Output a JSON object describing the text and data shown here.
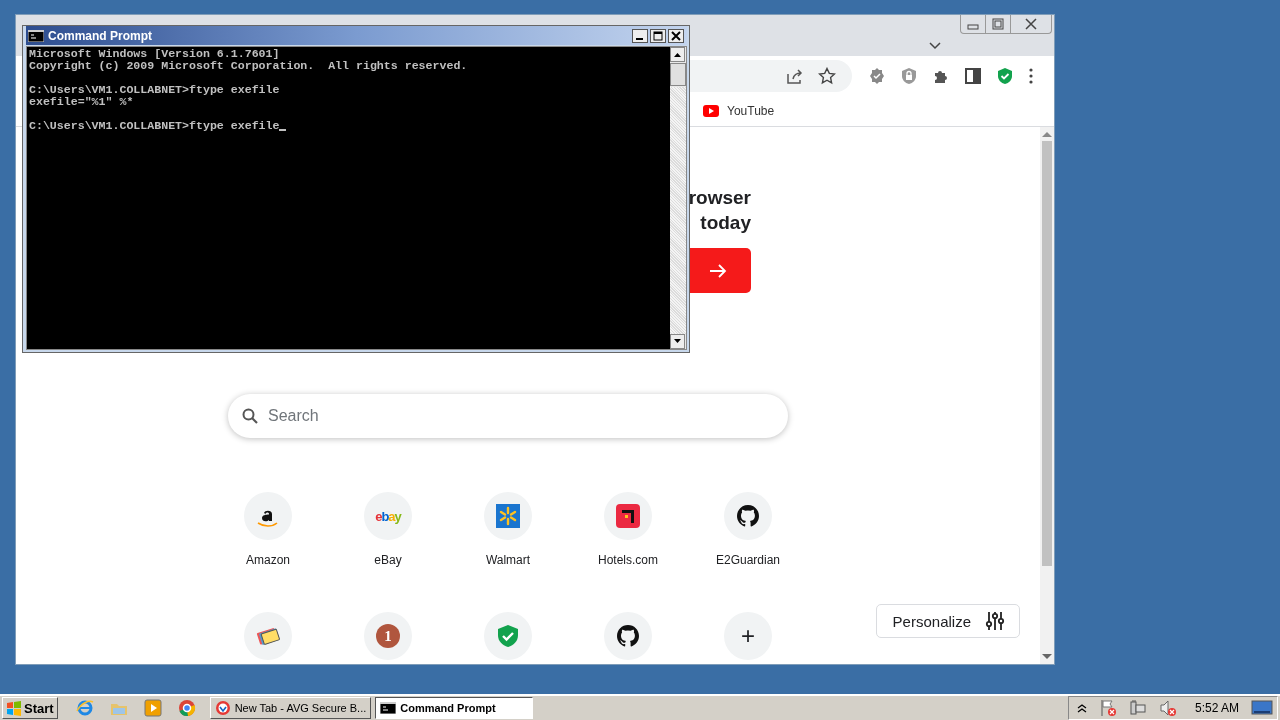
{
  "browser": {
    "bookmarks": [
      {
        "label": "YouTube"
      }
    ],
    "promo": {
      "lines": [
        "rowser",
        "today"
      ]
    },
    "search": {
      "placeholder": "Search"
    },
    "shortcuts": [
      {
        "kind": "amazon",
        "label": "Amazon"
      },
      {
        "kind": "ebay",
        "label": "eBay",
        "logo_text": "ebay"
      },
      {
        "kind": "walmart",
        "label": "Walmart"
      },
      {
        "kind": "hotels",
        "label": "Hotels.com"
      },
      {
        "kind": "github",
        "label": "E2Guardian"
      },
      {
        "kind": "cards"
      },
      {
        "kind": "coin",
        "logo_text": "1"
      },
      {
        "kind": "shield"
      },
      {
        "kind": "github"
      },
      {
        "kind": "add",
        "logo_text": "+"
      }
    ],
    "personalize": "Personalize"
  },
  "cmd": {
    "title": "Command Prompt",
    "blocks": [
      {
        "lines": [
          "Microsoft Windows [Version 6.1.7601]",
          "Copyright (c) 2009 Microsoft Corporation.  All rights reserved."
        ]
      },
      {
        "lines": [
          "C:\\Users\\VM1.COLLABNET>ftype exefile",
          "exefile=\"%1\" %*"
        ]
      },
      {
        "lines": [
          "C:\\Users\\VM1.COLLABNET>ftype exefile"
        ]
      }
    ]
  },
  "taskbar": {
    "start": "Start",
    "tasks": [
      {
        "kind": "browser",
        "label": "New Tab - AVG Secure B...",
        "selected": false
      },
      {
        "kind": "console",
        "label": "Command Prompt",
        "selected": true
      }
    ],
    "clock": "5:52 AM"
  }
}
